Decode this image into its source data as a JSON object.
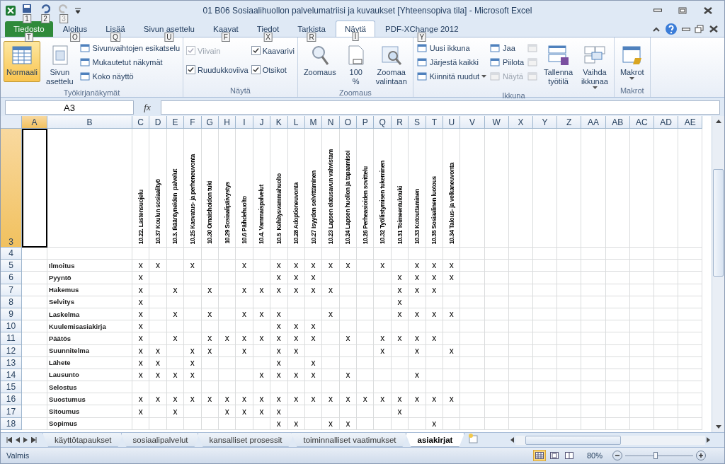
{
  "window": {
    "title": "01 B06 Sosiaalihuollon palvelumatriisi ja kuvaukset [Yhteensopiva tila] - Microsoft Excel"
  },
  "quick_access": [
    {
      "keytip": "1",
      "disabled": false
    },
    {
      "keytip": "2",
      "disabled": false
    },
    {
      "keytip": "3",
      "disabled": true
    }
  ],
  "ribbon_tabs": [
    {
      "label": "Tiedosto",
      "kind": "file",
      "selected": false,
      "keytip": "T"
    },
    {
      "label": "Aloitus",
      "kind": "tab",
      "selected": false,
      "keytip": "O"
    },
    {
      "label": "Lisää",
      "kind": "tab",
      "selected": false,
      "keytip": "Q"
    },
    {
      "label": "Sivun asettelu",
      "kind": "tab",
      "selected": false,
      "keytip": "U"
    },
    {
      "label": "Kaavat",
      "kind": "tab",
      "selected": false,
      "keytip": "F"
    },
    {
      "label": "Tiedot",
      "kind": "tab",
      "selected": false,
      "keytip": "X"
    },
    {
      "label": "Tarkista",
      "kind": "tab",
      "selected": false,
      "keytip": "R"
    },
    {
      "label": "Näytä",
      "kind": "tab",
      "selected": true,
      "keytip": "I"
    },
    {
      "label": "PDF-XChange 2012",
      "kind": "tab",
      "selected": false,
      "keytip": "Y"
    }
  ],
  "ribbon_groups": [
    {
      "label": "Työkirjanäkymät",
      "columns": [
        [
          {
            "kind": "large",
            "label": "Normaali",
            "selected": true
          }
        ],
        [
          {
            "kind": "large",
            "label": "Sivun asettelu",
            "selected": false
          }
        ],
        [
          {
            "kind": "small",
            "label": "Sivunvaihtojen esikatselu"
          },
          {
            "kind": "small",
            "label": "Mukautetut näkymät"
          },
          {
            "kind": "small",
            "label": "Koko näyttö"
          }
        ]
      ]
    },
    {
      "label": "Näytä",
      "columns": [
        [
          {
            "kind": "checkbox",
            "label": "Viivain",
            "checked": true,
            "disabled": true
          },
          {
            "kind": "checkbox",
            "label": "Ruudukkoviiva",
            "checked": true,
            "disabled": false
          }
        ],
        [
          {
            "kind": "checkbox",
            "label": "Kaavarivi",
            "checked": true,
            "disabled": false
          },
          {
            "kind": "checkbox",
            "label": "Otsikot",
            "checked": true,
            "disabled": false
          }
        ]
      ]
    },
    {
      "label": "Zoomaus",
      "columns": [
        [
          {
            "kind": "large",
            "label": "Zoomaus",
            "selected": false
          }
        ],
        [
          {
            "kind": "large",
            "label": "100 %",
            "selected": false
          }
        ],
        [
          {
            "kind": "large",
            "label": "Zoomaa valintaan",
            "selected": false
          }
        ]
      ]
    },
    {
      "label": "Ikkuna",
      "columns": [
        [
          {
            "kind": "small",
            "label": "Uusi ikkuna"
          },
          {
            "kind": "small",
            "label": "Järjestä kaikki"
          },
          {
            "kind": "small",
            "label": "Kiinnitä ruudut",
            "dropdown": true
          }
        ],
        [
          {
            "kind": "small",
            "label": "Jaa"
          },
          {
            "kind": "small",
            "label": "Piilota"
          },
          {
            "kind": "small",
            "label": "Näytä",
            "disabled": true
          }
        ],
        [
          {
            "kind": "icon",
            "disabled": true
          },
          {
            "kind": "icon",
            "disabled": true
          },
          {
            "kind": "icon",
            "disabled": true
          }
        ],
        [
          {
            "kind": "large",
            "label": "Tallenna työtilä",
            "selected": false
          }
        ],
        [
          {
            "kind": "large",
            "label": "Vaihda ikkunaa",
            "selected": false,
            "dropdown": true
          }
        ]
      ]
    },
    {
      "label": "Makrot",
      "columns": [
        [
          {
            "kind": "large",
            "label": "Makrot",
            "selected": false,
            "dropdown": true
          }
        ]
      ]
    }
  ],
  "formula_bar": {
    "name_box": "A3",
    "fx": "fx"
  },
  "columns": [
    {
      "label": "A",
      "selected": true
    },
    {
      "label": "B",
      "selected": false
    },
    {
      "label": "C",
      "selected": false
    },
    {
      "label": "D",
      "selected": false
    },
    {
      "label": "E",
      "selected": false
    },
    {
      "label": "F",
      "selected": false
    },
    {
      "label": "G",
      "selected": false
    },
    {
      "label": "H",
      "selected": false
    },
    {
      "label": "I",
      "selected": false
    },
    {
      "label": "J",
      "selected": false
    },
    {
      "label": "K",
      "selected": false
    },
    {
      "label": "L",
      "selected": false
    },
    {
      "label": "M",
      "selected": false
    },
    {
      "label": "N",
      "selected": false
    },
    {
      "label": "O",
      "selected": false
    },
    {
      "label": "P",
      "selected": false
    },
    {
      "label": "Q",
      "selected": false
    },
    {
      "label": "R",
      "selected": false
    },
    {
      "label": "S",
      "selected": false
    },
    {
      "label": "T",
      "selected": false
    },
    {
      "label": "U",
      "selected": false
    },
    {
      "label": "V",
      "selected": false
    },
    {
      "label": "W",
      "selected": false
    },
    {
      "label": "X",
      "selected": false
    },
    {
      "label": "Y",
      "selected": false
    },
    {
      "label": "Z",
      "selected": false
    },
    {
      "label": "AA",
      "selected": false
    },
    {
      "label": "AB",
      "selected": false
    },
    {
      "label": "AC",
      "selected": false
    },
    {
      "label": "AD",
      "selected": false
    },
    {
      "label": "AE",
      "selected": false
    }
  ],
  "header_row": {
    "number": "3",
    "selected": true,
    "titles": [
      "10.22. Lastensuojelu",
      "10.37 Koulun sosiaalityö",
      "10.3. Ikääntyneiden  palvelut",
      "10.25 Kasvatus- ja perheneuvonta",
      "10.30 Omaishoidon tuki",
      "10.29 Sosiaalipäivystys",
      "10.6 Päihdehuolto",
      "10.4. Vammaispalvelut",
      "10.5  Kehitysvammahuolto",
      "10.28 Adoptioneuvonta",
      "10.27 Isyyden selvittäminen",
      "10.23 Lapsen elatusavun vahvistam",
      "10.24 Lapsen huollon ja tapaamisoi",
      "10.26 Perheasioiden sovittelu",
      "10.32 Työllistymisen tukeminen",
      "10.31 Toimeentulotuki",
      "10.33 Kotouttaminen",
      "10.35 Sosiaalinen luotous",
      "10.34 Talous- ja velkaneuvonta"
    ]
  },
  "rows": [
    {
      "number": "4",
      "selected": false
    },
    {
      "number": "5",
      "selected": false,
      "label": "Ilmoitus",
      "cells": [
        "x",
        "x",
        null,
        "x",
        null,
        null,
        "x",
        null,
        "x",
        "x",
        "x",
        "x",
        "x",
        null,
        "x",
        null,
        "x",
        "x",
        "x"
      ]
    },
    {
      "number": "6",
      "selected": false,
      "label": "Pyyntö",
      "cells": [
        "x",
        null,
        null,
        null,
        null,
        null,
        null,
        null,
        "x",
        "x",
        "x",
        null,
        null,
        null,
        null,
        "x",
        "x",
        "x",
        "x"
      ]
    },
    {
      "number": "7",
      "selected": false,
      "label": "Hakemus",
      "cells": [
        "x",
        null,
        "x",
        null,
        "x",
        null,
        "x",
        "x",
        "x",
        "x",
        "x",
        "x",
        null,
        null,
        null,
        "x",
        "x",
        "x",
        null
      ]
    },
    {
      "number": "8",
      "selected": false,
      "label": "Selvitys",
      "cells": [
        "x",
        null,
        null,
        null,
        null,
        null,
        null,
        null,
        null,
        null,
        null,
        null,
        null,
        null,
        null,
        "x",
        null,
        null,
        null
      ]
    },
    {
      "number": "9",
      "selected": false,
      "label": "Laskelma",
      "cells": [
        "x",
        null,
        "x",
        null,
        "x",
        null,
        "x",
        "x",
        "x",
        null,
        null,
        "x",
        null,
        null,
        null,
        "x",
        "x",
        "x",
        "x"
      ]
    },
    {
      "number": "10",
      "selected": false,
      "label": "Kuulemisasiakirja",
      "cells": [
        "x",
        null,
        null,
        null,
        null,
        null,
        null,
        null,
        "x",
        "x",
        "x",
        null,
        null,
        null,
        null,
        null,
        null,
        null,
        null
      ]
    },
    {
      "number": "11",
      "selected": false,
      "label": "Päätös",
      "cells": [
        "x",
        null,
        "x",
        null,
        "x",
        "x",
        "x",
        "x",
        "x",
        "x",
        "x",
        null,
        "x",
        null,
        "x",
        "x",
        "x",
        "x",
        null
      ]
    },
    {
      "number": "12",
      "selected": false,
      "label": "Suunnitelma",
      "cells": [
        "x",
        "x",
        null,
        "x",
        "x",
        null,
        "x",
        null,
        "x",
        "x",
        null,
        null,
        null,
        null,
        "x",
        null,
        "x",
        null,
        "x"
      ]
    },
    {
      "number": "13",
      "selected": false,
      "label": "Lähete",
      "cells": [
        "x",
        "x",
        null,
        "x",
        null,
        null,
        null,
        null,
        "x",
        null,
        "x",
        null,
        null,
        null,
        null,
        null,
        null,
        null,
        null
      ]
    },
    {
      "number": "14",
      "selected": false,
      "label": "Lausunto",
      "cells": [
        "x",
        "x",
        "x",
        "x",
        null,
        null,
        null,
        "x",
        "x",
        "x",
        "x",
        null,
        "x",
        null,
        null,
        null,
        "x",
        null,
        null
      ]
    },
    {
      "number": "15",
      "selected": false,
      "label": "Selostus"
    },
    {
      "number": "16",
      "selected": false,
      "label": "Suostumus",
      "cells": [
        "x",
        "x",
        "x",
        "x",
        "x",
        "x",
        "x",
        "x",
        "x",
        "x",
        "x",
        "x",
        "x",
        "x",
        "x",
        "x",
        "x",
        "x",
        "x"
      ]
    },
    {
      "number": "17",
      "selected": false,
      "label": "Sitoumus",
      "cells": [
        "x",
        null,
        "x",
        null,
        null,
        "x",
        "x",
        "x",
        "x",
        null,
        null,
        null,
        null,
        null,
        null,
        "x",
        null,
        null,
        null
      ]
    },
    {
      "number": "18",
      "selected": false,
      "label": "Sopimus",
      "cells": [
        null,
        null,
        null,
        null,
        null,
        null,
        null,
        null,
        "x",
        "x",
        null,
        "x",
        "x",
        null,
        null,
        null,
        null,
        "x",
        null
      ]
    }
  ],
  "sheet_tabs": [
    {
      "label": "käyttötapaukset",
      "selected": false
    },
    {
      "label": "sosiaalipalvelut",
      "selected": false
    },
    {
      "label": "kansalliset prosessit",
      "selected": false
    },
    {
      "label": "toiminnalliset vaatimukset",
      "selected": false
    },
    {
      "label": "asiakirjat",
      "selected": true
    }
  ],
  "status_bar": {
    "status": "Valmis",
    "zoom": "80%",
    "zoom_slider": {
      "level": 0.45
    }
  }
}
